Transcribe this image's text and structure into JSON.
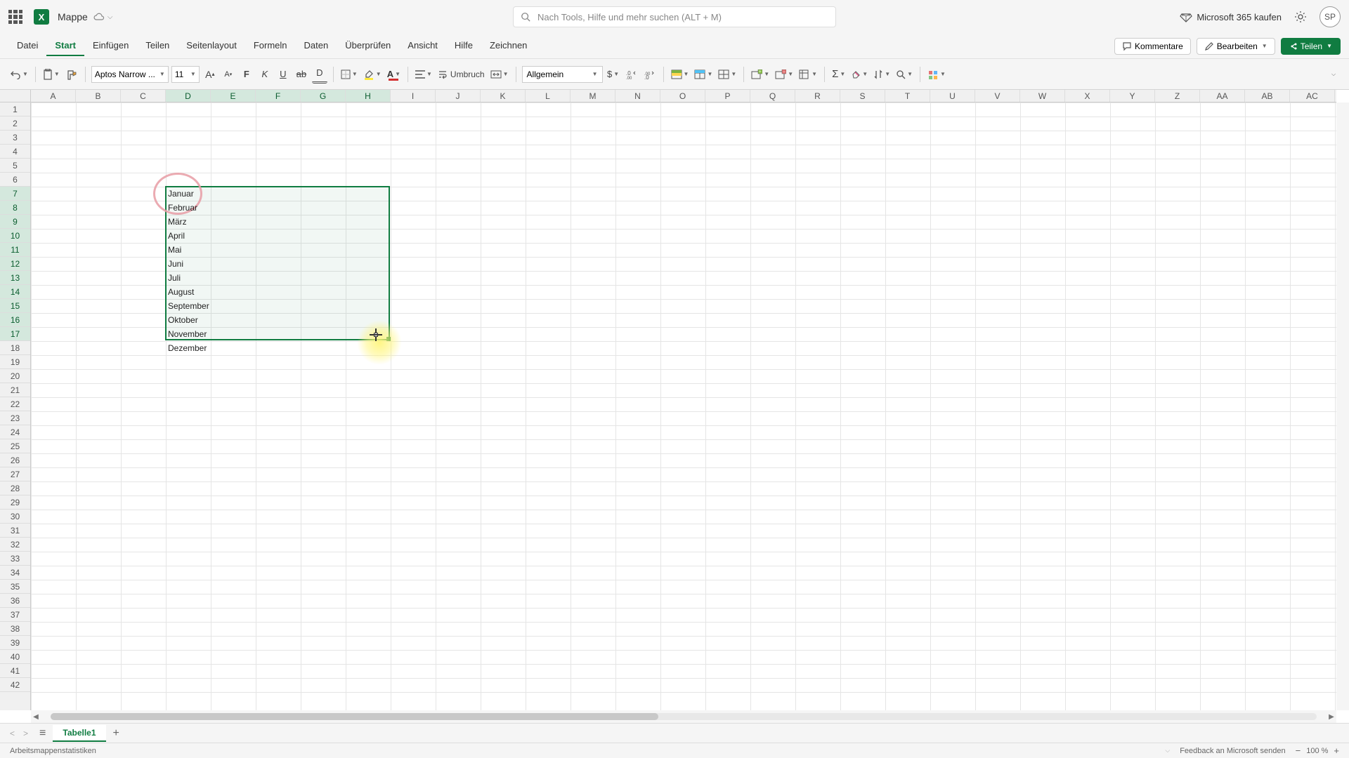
{
  "title": {
    "doc_name": "Mappe"
  },
  "search": {
    "placeholder": "Nach Tools, Hilfe und mehr suchen (ALT + M)"
  },
  "header_right": {
    "buy": "Microsoft 365 kaufen",
    "avatar": "SP"
  },
  "menu": {
    "items": [
      "Datei",
      "Start",
      "Einfügen",
      "Teilen",
      "Seitenlayout",
      "Formeln",
      "Daten",
      "Überprüfen",
      "Ansicht",
      "Hilfe",
      "Zeichnen"
    ],
    "active_index": 1,
    "comments": "Kommentare",
    "edit": "Bearbeiten",
    "share": "Teilen"
  },
  "toolbar": {
    "font": "Aptos Narrow ...",
    "size": "11",
    "wrap": "Umbruch",
    "number_format": "Allgemein"
  },
  "columns": [
    "A",
    "B",
    "C",
    "D",
    "E",
    "F",
    "G",
    "H",
    "I",
    "J",
    "K",
    "L",
    "M",
    "N",
    "O",
    "P",
    "Q",
    "R",
    "S",
    "T",
    "U",
    "V",
    "W",
    "X",
    "Y",
    "Z",
    "AA",
    "AB",
    "AC"
  ],
  "selected_cols": [
    "D",
    "E",
    "F",
    "G",
    "H"
  ],
  "selected_rows": [
    7,
    8,
    9,
    10,
    11,
    12,
    13,
    14,
    15,
    16,
    17
  ],
  "row_count": 42,
  "cells": [
    {
      "row": 7,
      "col": "D",
      "value": "Januar"
    },
    {
      "row": 8,
      "col": "D",
      "value": "Februar"
    },
    {
      "row": 9,
      "col": "D",
      "value": "März"
    },
    {
      "row": 10,
      "col": "D",
      "value": "April"
    },
    {
      "row": 11,
      "col": "D",
      "value": "Mai"
    },
    {
      "row": 12,
      "col": "D",
      "value": "Juni"
    },
    {
      "row": 13,
      "col": "D",
      "value": "Juli"
    },
    {
      "row": 14,
      "col": "D",
      "value": "August"
    },
    {
      "row": 15,
      "col": "D",
      "value": "September"
    },
    {
      "row": 16,
      "col": "D",
      "value": "Oktober"
    },
    {
      "row": 17,
      "col": "D",
      "value": "November"
    },
    {
      "row": 18,
      "col": "D",
      "value": "Dezember"
    }
  ],
  "sheet": {
    "tab": "Tabelle1"
  },
  "status": {
    "left": "Arbeitsmappenstatistiken",
    "feedback": "Feedback an Microsoft senden",
    "zoom": "100 %"
  }
}
